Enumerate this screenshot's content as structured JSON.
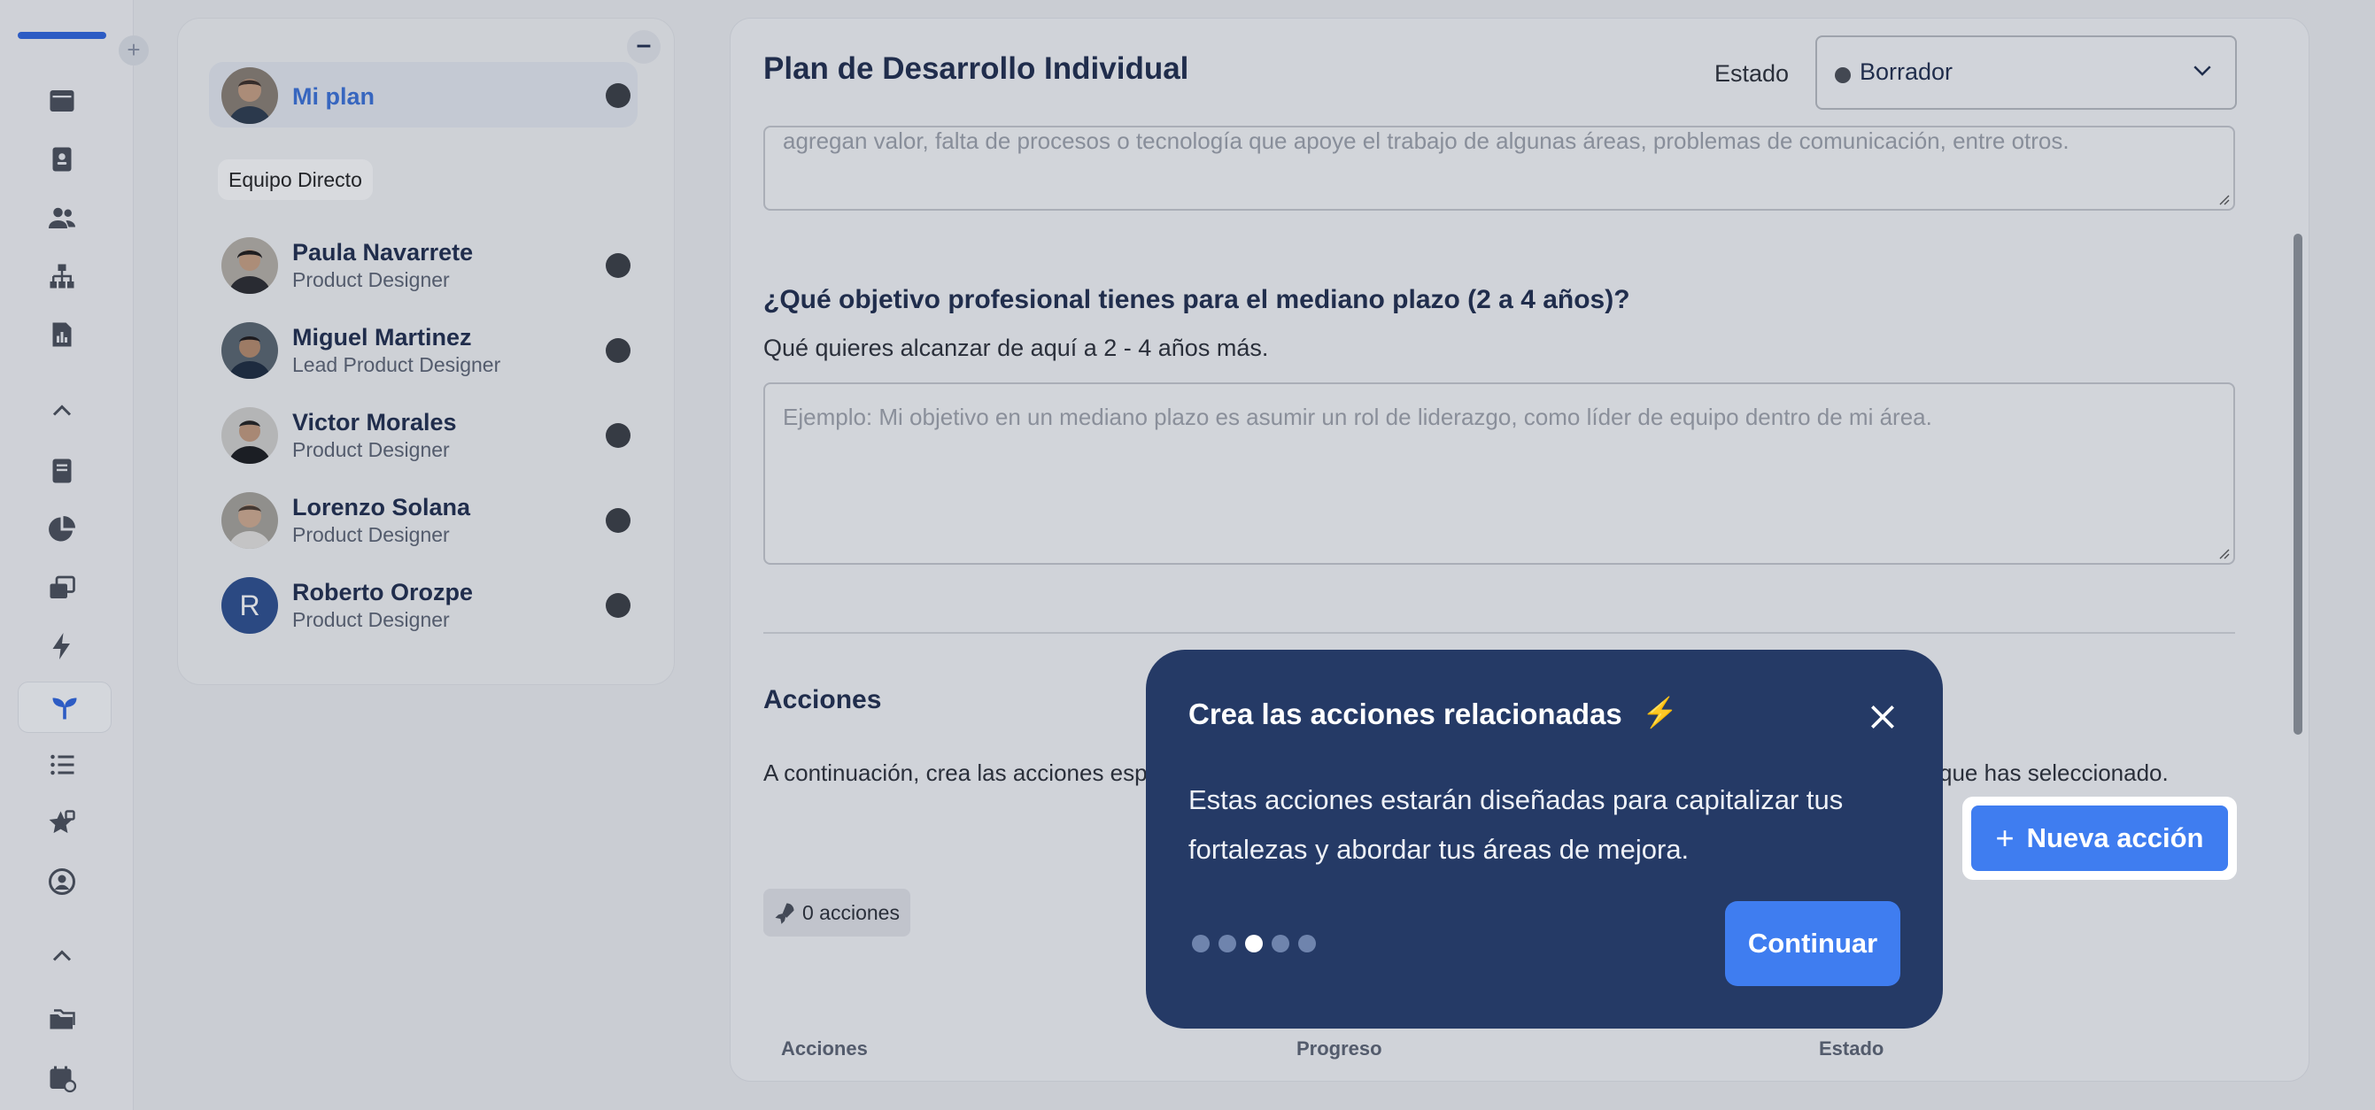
{
  "sidebar": {
    "icons": [
      "browser-window-icon",
      "id-card-icon",
      "users-icon",
      "org-chart-icon",
      "report-icon",
      "collapse-up-icon",
      "book-icon",
      "pie-chart-icon",
      "windows-icon",
      "bolt-icon",
      "sprout-icon",
      "list-icon",
      "star-icon",
      "user-circle-icon",
      "collapse-up-icon",
      "folders-icon",
      "calendar-icon"
    ],
    "active": "sprout-icon"
  },
  "team": {
    "my_plan": "Mi plan",
    "group_label": "Equipo Directo",
    "members": [
      {
        "name": "Paula Navarrete",
        "role": "Product Designer"
      },
      {
        "name": "Miguel Martinez",
        "role": "Lead Product Designer"
      },
      {
        "name": "Victor Morales",
        "role": "Product Designer"
      },
      {
        "name": "Lorenzo Solana",
        "role": "Product Designer"
      },
      {
        "name": "Roberto Orozpe",
        "role": "Product Designer",
        "initial": "R"
      }
    ]
  },
  "main": {
    "title": "Plan de Desarrollo Individual",
    "estado_label": "Estado",
    "estado_value": "Borrador",
    "prev_answer_text": "agregan valor, falta de procesos o tecnología que apoye el trabajo de algunas áreas, problemas de comunicación, entre otros.",
    "question_title": "¿Qué objetivo profesional tienes para el mediano plazo (2 a 4 años)?",
    "question_sub": "Qué quieres alcanzar de aquí a 2 - 4 años más.",
    "question_placeholder": "Ejemplo: Mi objetivo en un mediano plazo es asumir un rol de liderazgo, como líder de equipo dentro de mi área.",
    "acciones_title": "Acciones",
    "acciones_desc_start": "A continuación, crea las acciones esp",
    "acciones_desc_end": "que has seleccionado.",
    "new_action_label": "Nueva acción",
    "actions_count": "0 acciones",
    "table_headers": [
      "Acciones",
      "Progreso",
      "Estado"
    ]
  },
  "tooltip": {
    "title": "Crea las acciones relacionadas",
    "title_emoji": "⚡",
    "body": "Estas acciones estarán diseñadas para capitalizar tus fortalezas y abordar tus áreas de mejora.",
    "steps_total": 5,
    "current_step": 3,
    "continue_label": "Continuar"
  },
  "colors": {
    "brand": "#3f7df0",
    "tooltip_bg": "#253a66",
    "text_dark": "#1f2d4e",
    "link_blue": "#3b72d9"
  }
}
